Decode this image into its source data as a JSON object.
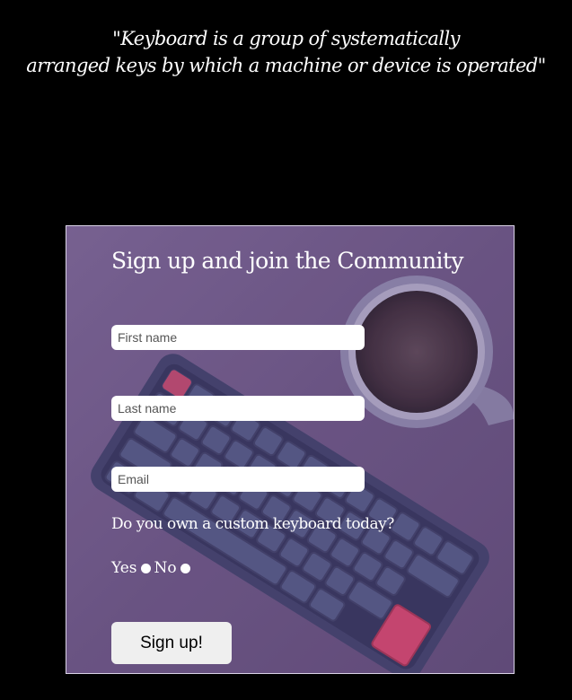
{
  "quote": {
    "line1": "\"Keyboard is a group of systematically",
    "line2": "arranged keys by which a machine or device is operated\""
  },
  "form": {
    "heading": "Sign up and join the Community",
    "first_name_placeholder": "First name",
    "last_name_placeholder": "Last name",
    "email_placeholder": "Email",
    "question": "Do you own a custom keyboard today?",
    "option_yes": "Yes",
    "option_no": "No",
    "submit_label": "Sign up!"
  },
  "colors": {
    "page_background": "#000000",
    "card_tint": "#6f5a86",
    "accent_key": "#d8446a"
  }
}
